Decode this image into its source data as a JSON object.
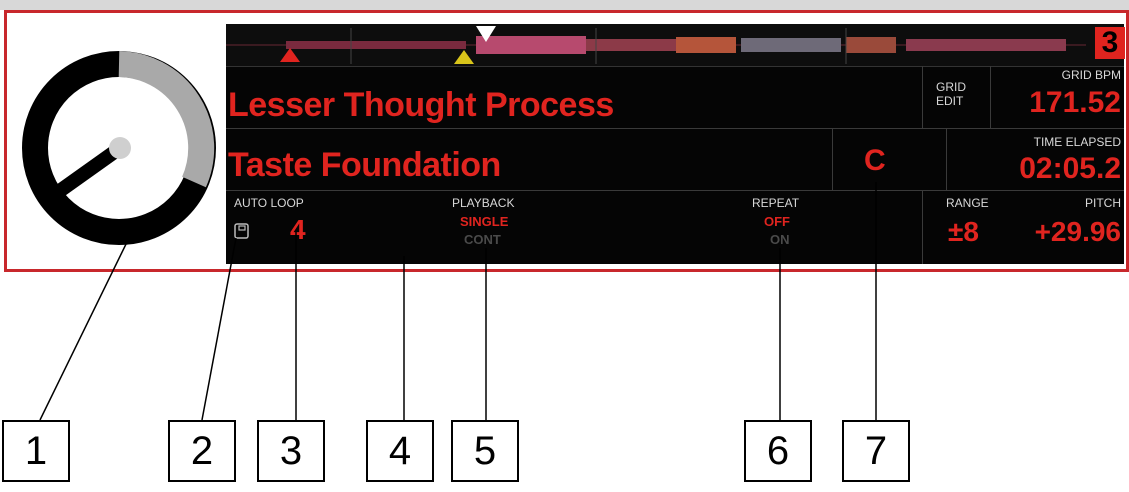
{
  "deck": {
    "number": "3",
    "title": "Lesser Thought Process",
    "artist": "Taste Foundation",
    "key": "C",
    "grid_edit_line1": "GRID",
    "grid_edit_line2": "EDIT",
    "grid_bpm_label": "GRID BPM",
    "grid_bpm_value": "171.52",
    "time_label": "TIME ELAPSED",
    "time_value": "02:05.2",
    "auto_loop_label": "AUTO LOOP",
    "auto_loop_value": "4",
    "playback_label": "PLAYBACK",
    "playback_single": "SINGLE",
    "playback_cont": "CONT",
    "repeat_label": "REPEAT",
    "repeat_off": "OFF",
    "repeat_on": "ON",
    "range_label": "RANGE",
    "range_value": "±8",
    "pitch_label": "PITCH",
    "pitch_value": "+29.96"
  },
  "callouts": [
    "1",
    "2",
    "3",
    "4",
    "5",
    "6",
    "7"
  ],
  "colors": {
    "accent_red": "#e0241f",
    "display_bg": "#050505",
    "marker_yellow": "#d8c41a"
  }
}
